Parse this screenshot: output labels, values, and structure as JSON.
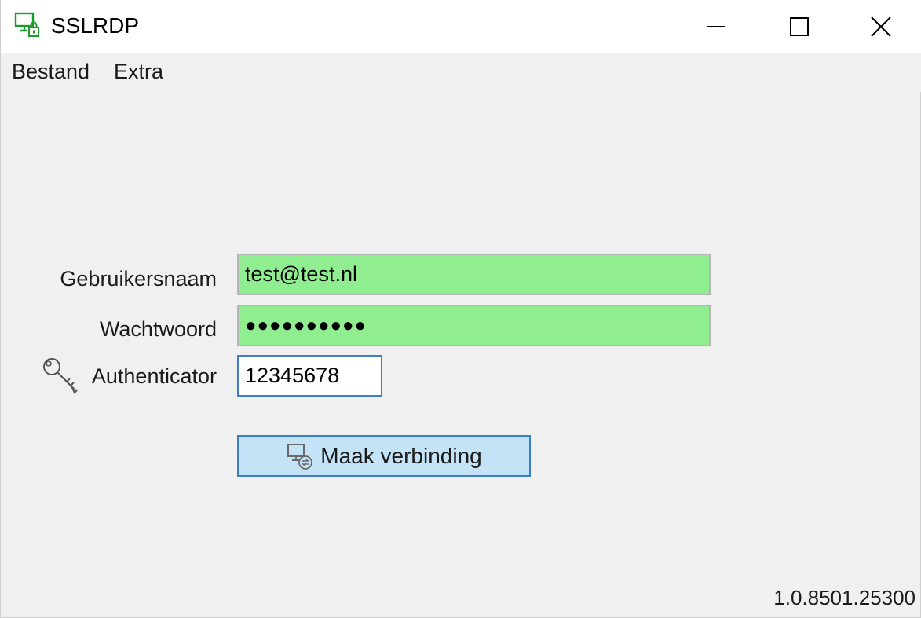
{
  "window": {
    "title": "SSLRDP",
    "app_icon": "monitor-lock-icon"
  },
  "menu": {
    "items": [
      {
        "label": "Bestand"
      },
      {
        "label": "Extra"
      }
    ]
  },
  "form": {
    "username": {
      "label": "Gebruikersnaam",
      "value": "test@test.nl"
    },
    "password": {
      "label": "Wachtwoord",
      "value": "●●●●●●●●●●"
    },
    "authenticator": {
      "label": "Authenticator",
      "value": "12345678",
      "icon": "key-icon"
    },
    "connect_button": {
      "label": "Maak verbinding",
      "icon": "remote-desktop-icon"
    }
  },
  "status": {
    "version": "1.0.8501.25300"
  },
  "colors": {
    "valid_field": "#90ee90",
    "button_bg": "#c5e3f7",
    "button_border": "#3b7fc4",
    "focus_border": "#3d7bd6",
    "icon_green": "#1a9c2a"
  }
}
